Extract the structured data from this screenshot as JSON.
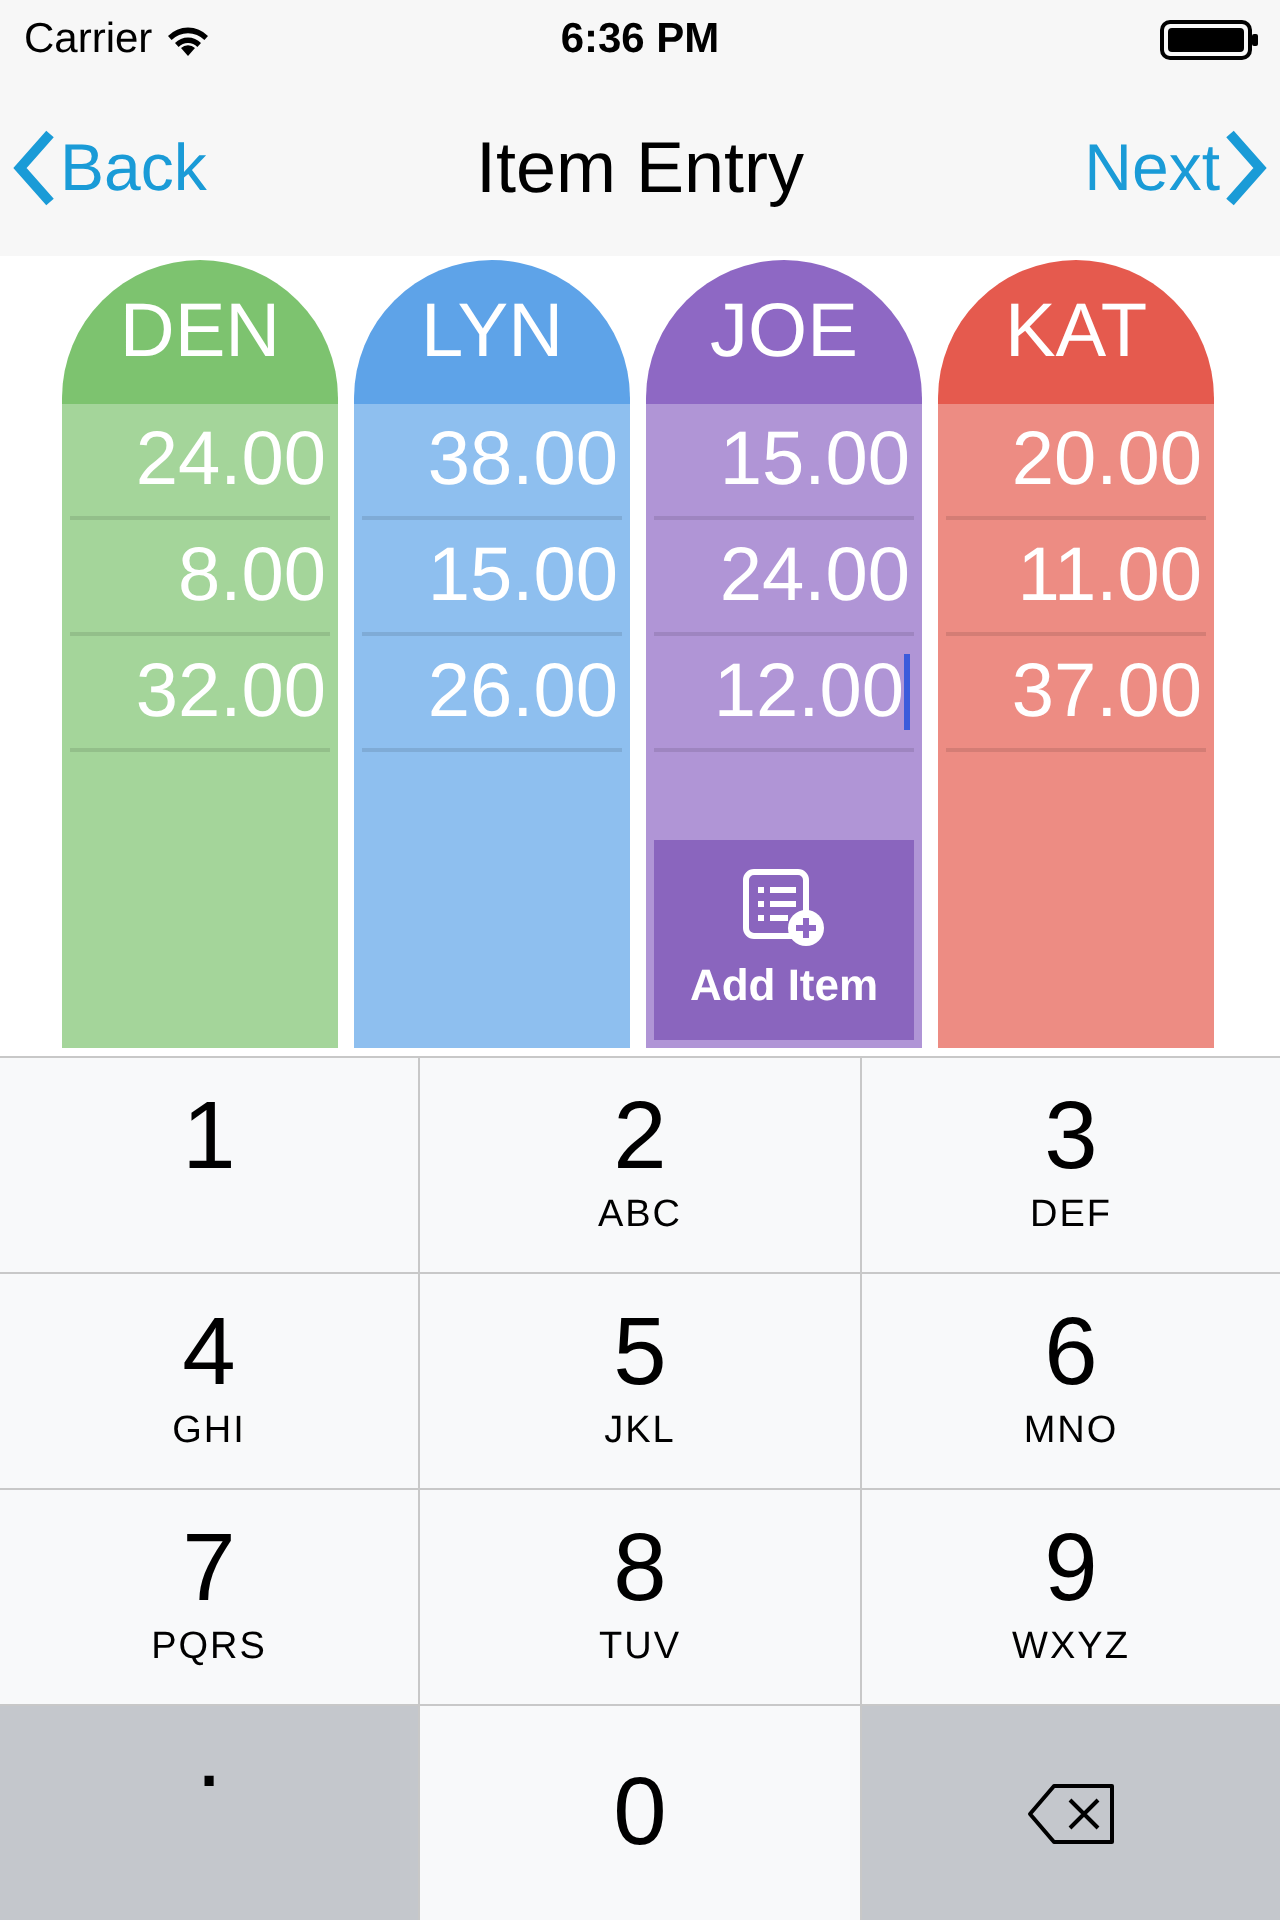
{
  "status_bar": {
    "carrier": "Carrier",
    "time": "6:36 PM"
  },
  "nav": {
    "back": "Back",
    "title": "Item Entry",
    "next": "Next"
  },
  "people": [
    {
      "name": "DEN",
      "color": "#7dc36f",
      "amounts": [
        {
          "value": "24.00",
          "focused": false
        },
        {
          "value": "8.00",
          "focused": false
        },
        {
          "value": "32.00",
          "focused": false
        }
      ]
    },
    {
      "name": "LYN",
      "color": "#5ea3e8",
      "amounts": [
        {
          "value": "38.00",
          "focused": false
        },
        {
          "value": "15.00",
          "focused": false
        },
        {
          "value": "26.00",
          "focused": false
        }
      ]
    },
    {
      "name": "JOE",
      "color": "#8e68c4",
      "amounts": [
        {
          "value": "15.00",
          "focused": false
        },
        {
          "value": "24.00",
          "focused": false
        },
        {
          "value": "12.00",
          "focused": true
        }
      ],
      "add_item": "Add Item"
    },
    {
      "name": "KAT",
      "color": "#e55a4e",
      "amounts": [
        {
          "value": "20.00",
          "focused": false
        },
        {
          "value": "11.00",
          "focused": false
        },
        {
          "value": "37.00",
          "focused": false
        }
      ]
    }
  ],
  "keypad": [
    {
      "kind": "digit",
      "digit": "1"
    },
    {
      "kind": "digit",
      "digit": "2",
      "letters": "ABC"
    },
    {
      "kind": "digit",
      "digit": "3",
      "letters": "DEF"
    },
    {
      "kind": "digit",
      "digit": "4",
      "letters": "GHI"
    },
    {
      "kind": "digit",
      "digit": "5",
      "letters": "JKL"
    },
    {
      "kind": "digit",
      "digit": "6",
      "letters": "MNO"
    },
    {
      "kind": "digit",
      "digit": "7",
      "letters": "PQRS"
    },
    {
      "kind": "digit",
      "digit": "8",
      "letters": "TUV"
    },
    {
      "kind": "digit",
      "digit": "9",
      "letters": "WXYZ"
    },
    {
      "kind": "decimal",
      "label": "."
    },
    {
      "kind": "digit",
      "digit": "0"
    },
    {
      "kind": "delete"
    }
  ]
}
